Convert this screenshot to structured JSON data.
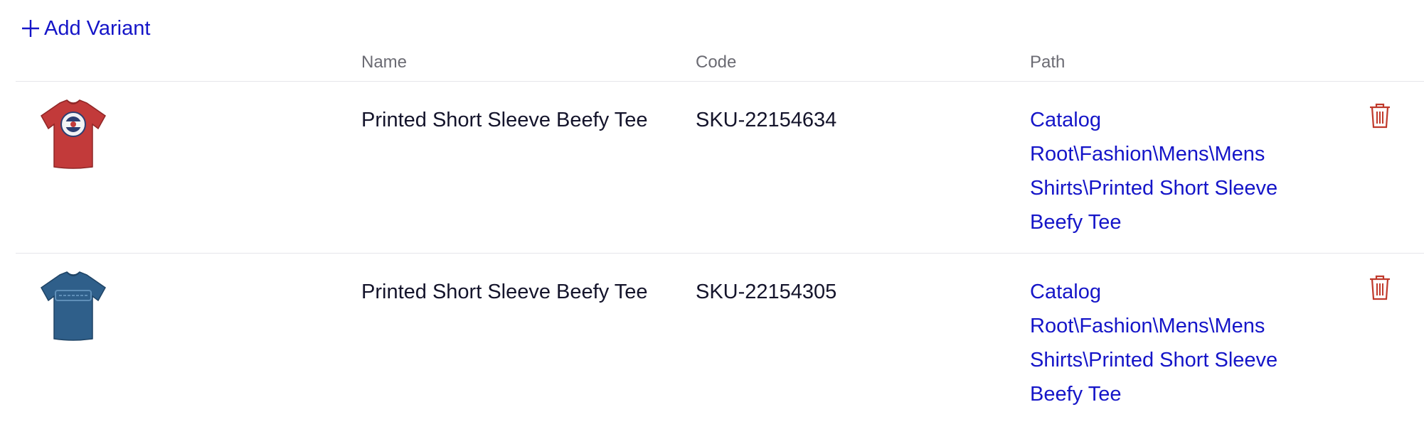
{
  "toolbar": {
    "add_variant_label": "Add Variant",
    "add_icon": "plus-icon"
  },
  "table": {
    "columns": {
      "name": "Name",
      "code": "Code",
      "path": "Path"
    },
    "rows": [
      {
        "image": "red-tshirt-thumbnail",
        "name": "Printed Short Sleeve Beefy Tee",
        "code": "SKU-22154634",
        "path_lines": [
          "Catalog",
          "Root\\Fashion\\Mens\\Mens",
          "Shirts\\Printed Short Sleeve",
          "Beefy Tee"
        ],
        "delete_icon": "trash-icon"
      },
      {
        "image": "blue-tshirt-thumbnail",
        "name": "Printed Short Sleeve Beefy Tee",
        "code": "SKU-22154305",
        "path_lines": [
          "Catalog",
          "Root\\Fashion\\Mens\\Mens",
          "Shirts\\Printed Short Sleeve",
          "Beefy Tee"
        ],
        "delete_icon": "trash-icon"
      }
    ]
  },
  "colors": {
    "link": "#1515c8",
    "delete": "#c0392b",
    "header_text": "#6b6b73",
    "divider": "#e6e6ea",
    "shirt_red": "#c23a3a",
    "shirt_blue": "#2f5f8a"
  }
}
